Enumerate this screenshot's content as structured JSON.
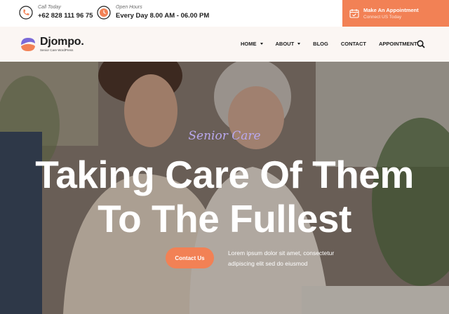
{
  "topbar": {
    "call": {
      "label": "Call Today",
      "value": "+62 828 111 96 75",
      "icon": "phone-icon"
    },
    "hours": {
      "label": "Open Hours",
      "value": "Every Day 8.00 AM - 06.00 PM",
      "icon": "clock-icon"
    },
    "appointment": {
      "title": "Make An Appointment",
      "subtitle": "Connect US Today",
      "icon": "calendar-icon"
    }
  },
  "nav": {
    "logo": {
      "name": "Djompo.",
      "tagline": "Senior Care WordPress"
    },
    "items": [
      {
        "label": "HOME",
        "dropdown": true
      },
      {
        "label": "ABOUT",
        "dropdown": true
      },
      {
        "label": "BLOG",
        "dropdown": false
      },
      {
        "label": "CONTACT",
        "dropdown": false
      },
      {
        "label": "APPOINTMENT",
        "dropdown": false
      }
    ],
    "search_icon": "search-icon"
  },
  "hero": {
    "subtitle": "Senior Care",
    "headline_line1": "Taking Care Of Them",
    "headline_line2": "To The Fullest",
    "cta_label": "Contact Us",
    "description": "Lorem ipsum dolor sit amet, consectetur adipiscing elit sed do eiusmod"
  },
  "colors": {
    "accent": "#f28155",
    "subtitle": "#b9a8ee",
    "nav_bg": "#fbf6f3",
    "text_dark": "#1d1d1d"
  }
}
